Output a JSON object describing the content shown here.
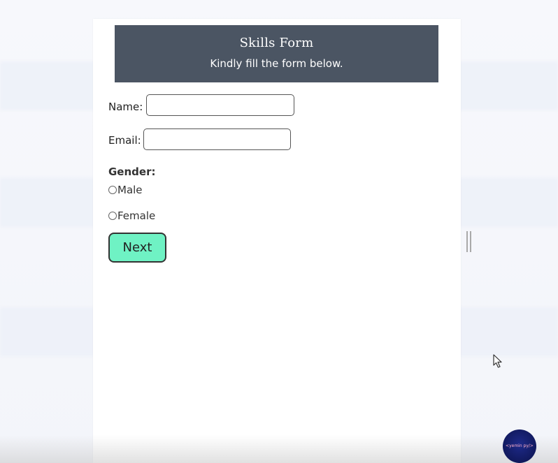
{
  "header": {
    "title": "Skills Form",
    "subtitle": "Kindly fill the form below."
  },
  "form": {
    "name_label": "Name:",
    "name_value": "",
    "email_label": "Email:",
    "email_value": "",
    "gender_label": "Gender:",
    "gender_options": [
      {
        "label": "Male",
        "selected": false
      },
      {
        "label": "Female",
        "selected": false
      }
    ],
    "next_label": "Next"
  },
  "watermark": {
    "text": "<yemin py/>"
  },
  "colors": {
    "header_bg": "#4b5563",
    "next_button_bg": "#6ff2c4",
    "logo_bg": "#0b124a"
  },
  "icons": {
    "cursor": "mouse-pointer-icon",
    "resize": "resize-handle-icon"
  }
}
